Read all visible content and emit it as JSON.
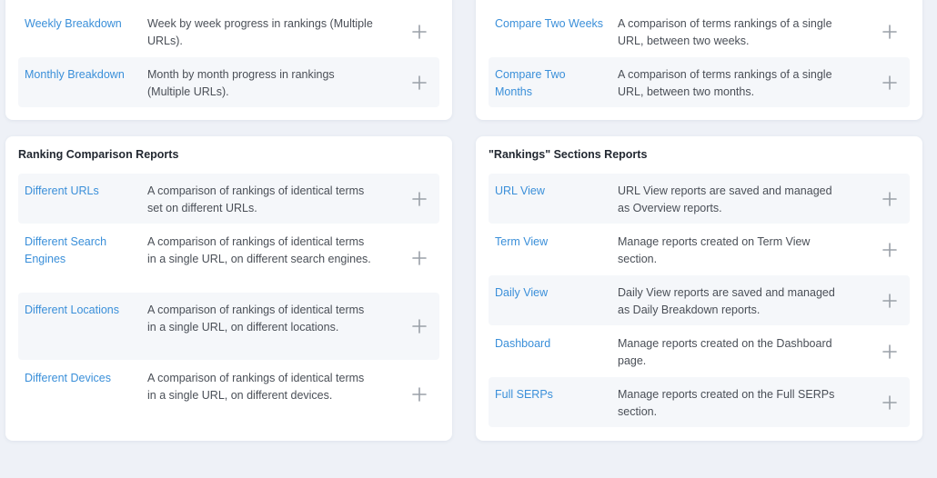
{
  "colors": {
    "background": "#eef1f7",
    "card": "#ffffff",
    "link": "#3a8fd9",
    "text": "#4a4f57",
    "title": "#222831",
    "icon": "#9aa0a8"
  },
  "icons": {
    "add": "plus-icon"
  },
  "top_left": {
    "items": [
      {
        "name": "Weekly Breakdown",
        "desc": "Week by week progress in rankings (Multiple URLs)."
      },
      {
        "name": "Monthly Breakdown",
        "desc": "Month by month progress in rankings (Multiple URLs)."
      }
    ]
  },
  "top_right": {
    "items": [
      {
        "name": "Compare Two Weeks",
        "desc": "A comparison of terms rankings of a single URL, between two weeks."
      },
      {
        "name": "Compare Two Months",
        "desc": "A comparison of terms rankings of a single URL, between two months."
      }
    ]
  },
  "ranking_comparison": {
    "title": "Ranking Comparison Reports",
    "items": [
      {
        "name": "Different URLs",
        "desc": "A comparison of rankings of identical terms set on different URLs."
      },
      {
        "name": "Different Search Engines",
        "desc": "A comparison of rankings of identical terms in a single URL, on different search engines."
      },
      {
        "name": "Different Locations",
        "desc": "A comparison of rankings of identical terms in a single URL, on different locations."
      },
      {
        "name": "Different Devices",
        "desc": "A comparison of rankings of identical terms in a single URL, on different devices."
      }
    ]
  },
  "rankings_sections": {
    "title": "\"Rankings\" Sections Reports",
    "items": [
      {
        "name": "URL View",
        "desc": "URL View reports are saved and managed as Overview reports."
      },
      {
        "name": "Term View",
        "desc": "Manage reports created on Term View section."
      },
      {
        "name": "Daily View",
        "desc": "Daily View reports are saved and managed as Daily Breakdown reports."
      },
      {
        "name": "Dashboard",
        "desc": "Manage reports created on the Dashboard page."
      },
      {
        "name": "Full SERPs",
        "desc": "Manage reports created on the Full SERPs section."
      }
    ]
  }
}
